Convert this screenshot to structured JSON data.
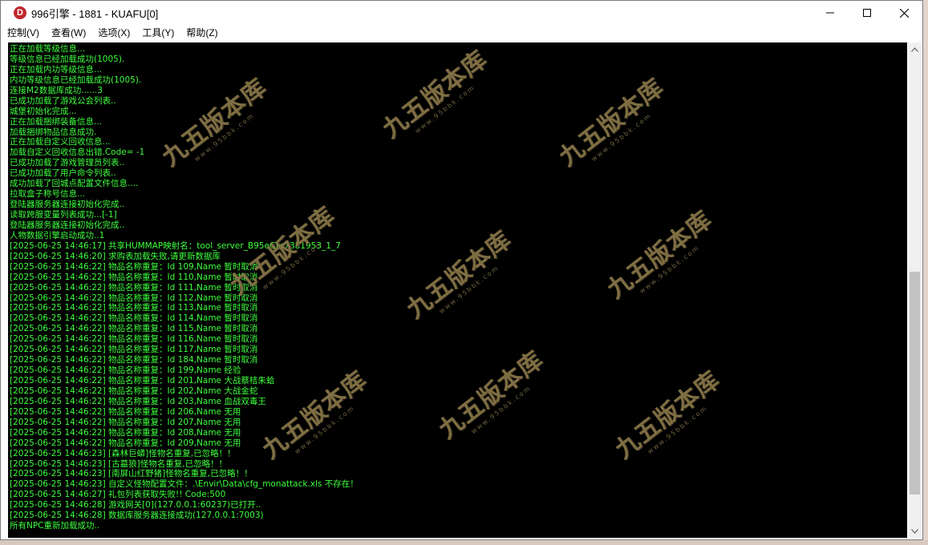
{
  "window": {
    "title": "996引擎 - 1881 - KUAFU[0]",
    "icon_letter": "D",
    "accent_color": "#c0272d"
  },
  "menu": [
    {
      "label": "控制(V)"
    },
    {
      "label": "查看(W)"
    },
    {
      "label": "选项(X)"
    },
    {
      "label": "工具(Y)"
    },
    {
      "label": "帮助(Z)"
    }
  ],
  "console": {
    "text_color": "#3dff3d",
    "lines": [
      "正在加载等级信息...",
      "等级信息已经加载成功(1005).",
      "正在加载内功等级信息...",
      "内功等级信息已经加载成功(1005).",
      "连接M2数据库成功......3",
      "已成功加载了游戏公会列表..",
      "城堡初始化完成...",
      "正在加载捆绑装备信息...",
      "加载捆绑物品信息成功.",
      "正在加载自定义回收信息...",
      "加载自定义回收信息出错.Code= -1",
      "已成功加载了游戏管理员列表..",
      "已成功加载了用户命令列表..",
      "成功加载了回城点配置文件信息....",
      "拉取盒子称号信息...",
      "登陆器服务器连接初始化完成..",
      "读取跨服变量列表成功...[-1]",
      "登陆器服务器连接初始化完成..",
      "人物数据引擎启动成功..1",
      "[2025-06-25 14:46:17] 共享HUMMAP映射名：tool_server_B95eGm7381953_1_7",
      "[2025-06-25 14:46:20] 求购表加载失败,请更新数据库",
      "[2025-06-25 14:46:22] 物品名称重复：Id 109,Name 暂时取消",
      "[2025-06-25 14:46:22] 物品名称重复：Id 110,Name 暂时取消",
      "[2025-06-25 14:46:22] 物品名称重复：Id 111,Name 暂时取消",
      "[2025-06-25 14:46:22] 物品名称重复：Id 112,Name 暂时取消",
      "[2025-06-25 14:46:22] 物品名称重复：Id 113,Name 暂时取消",
      "[2025-06-25 14:46:22] 物品名称重复：Id 114,Name 暂时取消",
      "[2025-06-25 14:46:22] 物品名称重复：Id 115,Name 暂时取消",
      "[2025-06-25 14:46:22] 物品名称重复：Id 116,Name 暂时取消",
      "[2025-06-25 14:46:22] 物品名称重复：Id 117,Name 暂时取消",
      "[2025-06-25 14:46:22] 物品名称重复：Id 184,Name 暂时取消",
      "[2025-06-25 14:46:22] 物品名称重复：Id 199,Name 经验",
      "[2025-06-25 14:46:22] 物品名称重复：Id 201,Name 大战蔡桔朱蛤",
      "[2025-06-25 14:46:22] 物品名称重复：Id 202,Name 大战金蛇",
      "[2025-06-25 14:46:22] 物品名称重复：Id 203,Name 血战双毒王",
      "[2025-06-25 14:46:22] 物品名称重复：Id 206,Name 无用",
      "[2025-06-25 14:46:22] 物品名称重复：Id 207,Name 无用",
      "[2025-06-25 14:46:22] 物品名称重复：Id 208,Name 无用",
      "[2025-06-25 14:46:22] 物品名称重复：Id 209,Name 无用",
      "[2025-06-25 14:46:23] [森林巨蟒]怪物名重复,已忽略！！",
      "[2025-06-25 14:46:23] [古墓狼]怪物名重复,已忽略！！",
      "[2025-06-25 14:46:23] [南屏山红野猪]怪物名重复,已忽略！！",
      "[2025-06-25 14:46:23] 自定义怪物配置文件：.\\Envir\\Data\\cfg_monattack.xls 不存在！",
      "[2025-06-25 14:46:27] 礼包列表获取失败!! Code:500",
      "[2025-06-25 14:46:28] 游戏网关[0](127.0.0.1:60237)已打开..",
      "[2025-06-25 14:46:28] 数据库服务器连接成功(127.0.0.1:7003)",
      "所有NPC重新加载成功.."
    ]
  },
  "watermark": {
    "brand": "九五版本库",
    "url": "www.95bbk.com",
    "color": "#8c7a4a"
  },
  "icons": {
    "minimize": "minimize-icon",
    "maximize": "maximize-icon",
    "close": "close-icon",
    "scroll_up": "chevron-up-icon",
    "scroll_down": "chevron-down-icon"
  }
}
